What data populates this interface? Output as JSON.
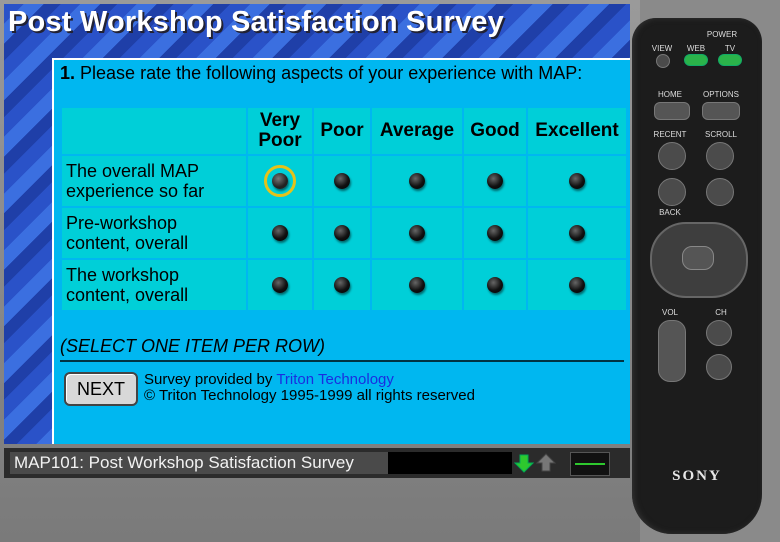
{
  "window": {
    "title": "Post Workshop Satisfaction Survey"
  },
  "question": {
    "number": "1.",
    "text": "Please rate the following aspects of your experience with MAP:"
  },
  "survey": {
    "columns": [
      "Very Poor",
      "Poor",
      "Average",
      "Good",
      "Excellent"
    ],
    "rows": [
      "The overall MAP experience so far",
      "Pre-workshop content, overall",
      "The workshop content, overall"
    ],
    "focused": {
      "row": 0,
      "column": 0
    }
  },
  "hint": "(SELECT ONE ITEM PER ROW)",
  "next_label": "NEXT",
  "credit": {
    "prefix": "Survey provided by ",
    "link": "Triton Technology",
    "copyright": "© Triton Technology 1995-1999 all rights reserved"
  },
  "statusbar": {
    "text": "MAP101: Post Workshop Satisfaction Survey"
  },
  "remote": {
    "brand": "SONY",
    "labels": {
      "power": "POWER",
      "view": "VIEW",
      "web": "WEB",
      "tv": "TV",
      "home": "HOME",
      "options": "OPTIONS",
      "recent": "RECENT",
      "scroll": "SCROLL",
      "back": "BACK",
      "vol": "VOL",
      "ch": "CH"
    }
  },
  "colors": {
    "content_bg": "#00b7f0",
    "cell_bg": "#00cfd8",
    "focus": "#e6c21a"
  },
  "icons": [
    "down-arrow-icon",
    "up-arrow-icon",
    "radio-button-icon"
  ]
}
